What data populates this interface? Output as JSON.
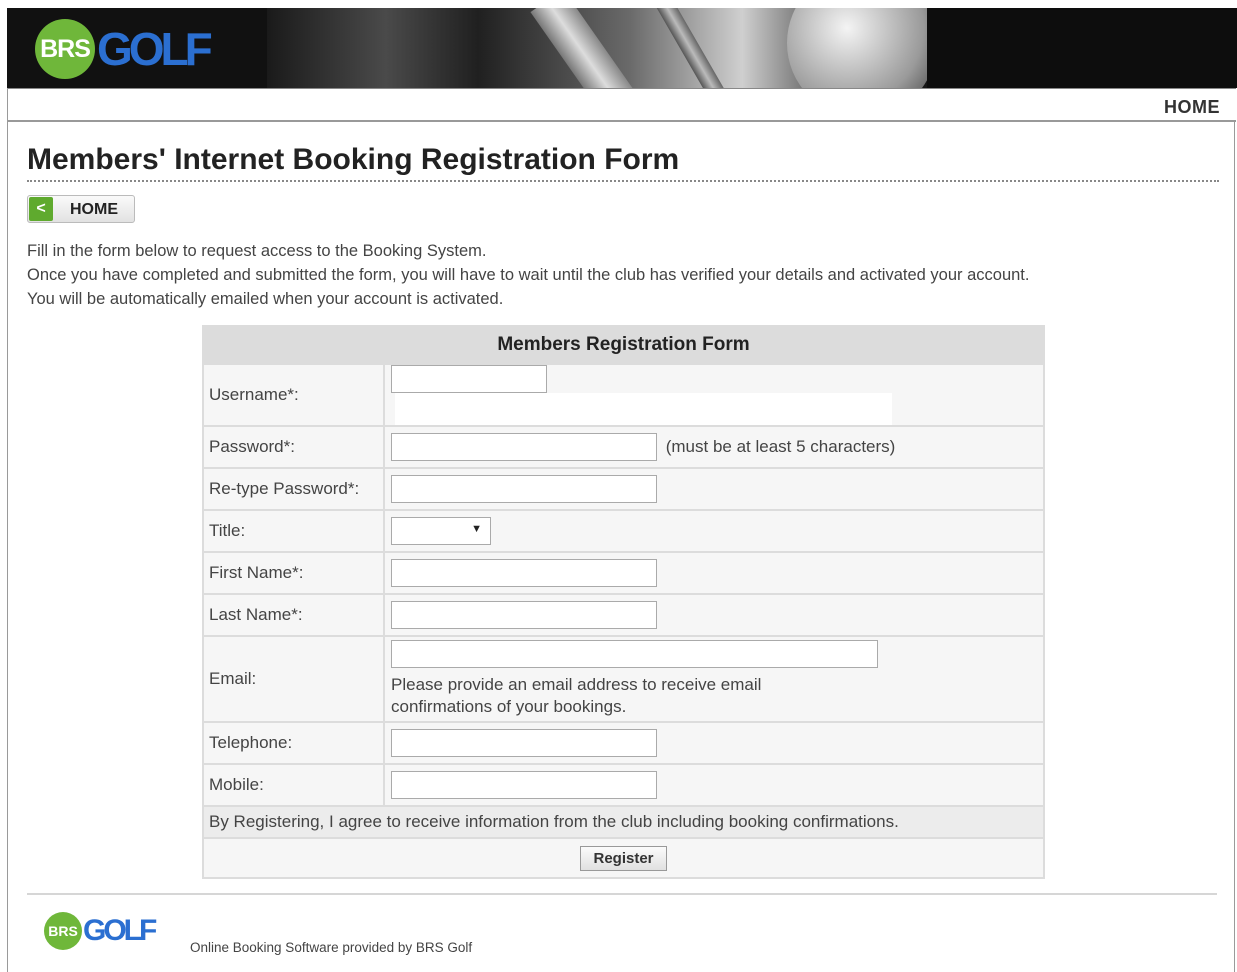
{
  "header": {
    "logo_brs": "BRS",
    "logo_golf": "GOLF",
    "nav_home": "HOME"
  },
  "main": {
    "title": "Members' Internet Booking Registration Form",
    "home_button_label": "HOME",
    "home_button_arrow": "<",
    "intro_lines": [
      "Fill in the form below to request access to the Booking System.",
      "Once you have completed and submitted the form, you will have to wait until the club has verified your details and activated your account.",
      "You will be automatically emailed when your account is activated."
    ]
  },
  "form": {
    "heading": "Members Registration Form",
    "fields": {
      "username": {
        "label": "Username*:",
        "value": ""
      },
      "password": {
        "label": "Password*:",
        "value": "",
        "hint": "(must be at least 5 characters)"
      },
      "retype_password": {
        "label": "Re-type Password*:",
        "value": ""
      },
      "title": {
        "label": "Title:",
        "selected": ""
      },
      "first_name": {
        "label": "First Name*:",
        "value": ""
      },
      "last_name": {
        "label": "Last Name*:",
        "value": ""
      },
      "email": {
        "label": "Email:",
        "value": "",
        "note_line1": "Please provide an email address to receive email",
        "note_line2": "confirmations of your bookings."
      },
      "telephone": {
        "label": "Telephone:",
        "value": ""
      },
      "mobile": {
        "label": "Mobile:",
        "value": ""
      }
    },
    "agreement": "By Registering, I agree to receive information from the club including booking confirmations.",
    "register_label": "Register"
  },
  "footer": {
    "logo_brs": "BRS",
    "logo_golf": "GOLF",
    "credit": "Online Booking Software provided by BRS Golf"
  },
  "colors": {
    "brand_green": "#6fb73a",
    "brand_blue": "#2b6fd1",
    "banner_dark": "#111111"
  }
}
